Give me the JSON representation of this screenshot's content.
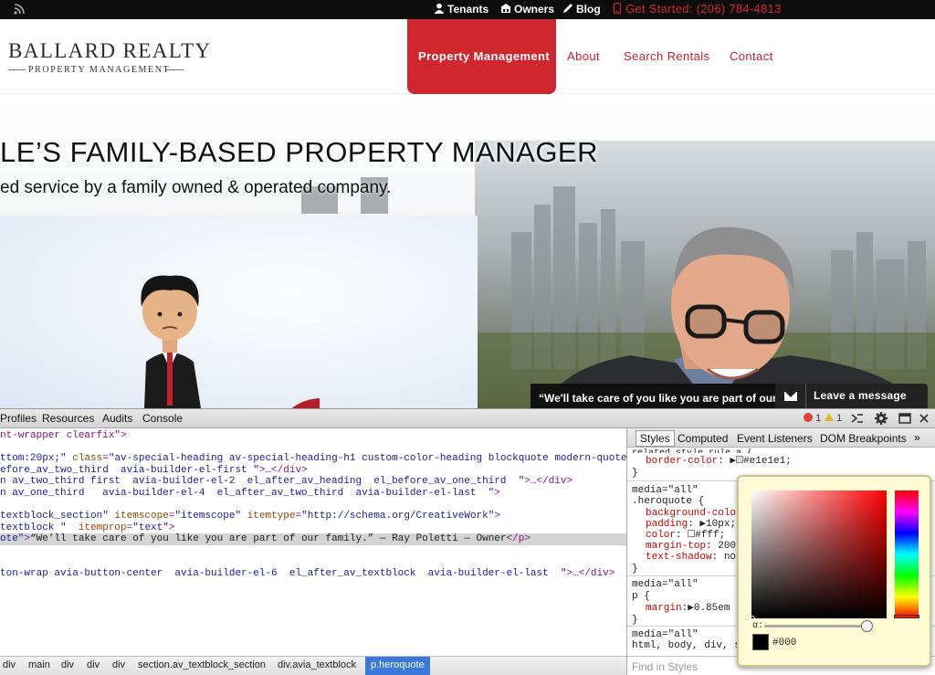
{
  "topbar": {
    "tenants": "Tenants",
    "owners": "Owners",
    "blog": "Blog",
    "get_started": "Get Started: (206) 784-4813"
  },
  "header": {
    "logo_main": "BALLARD REALTY",
    "logo_sub": "PROPERTY MANAGEMENT",
    "nav": [
      "Property Management",
      "About",
      "Search Rentals",
      "Contact"
    ]
  },
  "hero": {
    "title": "LE’S FAMILY-BASED PROPERTY MANAGER",
    "subtitle": "ed service by a family owned & operated company.",
    "quote": "“We'll take care of you like you are part of our",
    "leave_message": "Leave a message",
    "video_badge": "IS SU"
  },
  "devtools": {
    "tabs": [
      "Profiles",
      "Resources",
      "Audits",
      "Console"
    ],
    "error_count": "1",
    "warning_count": "1",
    "dom_lines": [
      {
        "parts": [
          [
            "tg",
            "nt-wrapper clearfix\">"
          ]
        ]
      },
      {
        "parts": [
          [
            "tg",
            ""
          ]
        ]
      },
      {
        "parts": [
          [
            "av",
            "ttom:20px;\""
          ],
          [
            "an",
            " class"
          ],
          [
            "tg",
            "="
          ],
          [
            "av",
            "\"av-special-heading av-special-heading-h1 custom-color-heading blockquote modern-quote"
          ]
        ]
      },
      {
        "parts": [
          [
            "av",
            "efore_av_two_third  avia-builder-el-first \""
          ],
          [
            "tg",
            ">…</div>"
          ]
        ]
      },
      {
        "parts": [
          [
            "av",
            "n av_two_third first  avia-builder-el-2  el_after_av_heading  el_before_av_one_third  \""
          ],
          [
            "tg",
            ">…</div>"
          ]
        ]
      },
      {
        "parts": [
          [
            "av",
            "n av_one_third   avia-builder-el-4  el_after_av_two_third  avia-builder-el-last  \""
          ],
          [
            "tg",
            ">"
          ]
        ]
      },
      {
        "parts": [
          [
            "tg",
            ""
          ]
        ]
      },
      {
        "parts": [
          [
            "av",
            "textblock_section\""
          ],
          [
            "an",
            " itemscope"
          ],
          [
            "tg",
            "="
          ],
          [
            "av",
            "\"itemscope\""
          ],
          [
            "an",
            " itemtype"
          ],
          [
            "tg",
            "="
          ],
          [
            "av",
            "\"http://schema.org/CreativeWork\""
          ],
          [
            "tg",
            ">"
          ]
        ]
      },
      {
        "parts": [
          [
            "av",
            "textblock \""
          ],
          [
            "an",
            "  itemprop"
          ],
          [
            "tg",
            "="
          ],
          [
            "av",
            "\"text\""
          ],
          [
            "tg",
            ">"
          ]
        ]
      },
      {
        "parts": [
          [
            "av",
            "ote\""
          ],
          [
            "tg",
            ">"
          ],
          [
            "tx",
            "“We’ll take care of you like you are part of our family.” — Ray Poletti — Owner"
          ],
          [
            "tg",
            "</p>"
          ]
        ]
      },
      {
        "parts": [
          [
            "tg",
            ""
          ]
        ]
      },
      {
        "parts": [
          [
            "tg",
            ""
          ]
        ]
      },
      {
        "parts": [
          [
            "av",
            "ton-wrap avia-button-center  avia-builder-el-6  el_after_av_textblock  avia-builder-el-last  \""
          ],
          [
            "tg",
            ">…</div>"
          ]
        ]
      }
    ],
    "breadcrumbs": [
      "div",
      "main",
      "div",
      "div",
      "div",
      "section.av_textblock_section",
      "div.avia_textblock",
      "p.heroquote"
    ],
    "sidebar_tabs": [
      "Styles",
      "Computed",
      "Event Listeners",
      "DOM Breakpoints"
    ],
    "css_lines": {
      "related": "related style rule a {",
      "border_prop": "border-color",
      "border_val": "#e1e1e1;",
      "brace1": "}",
      "media1": "media=\"all\"",
      "selector1": ".heroquote {",
      "p1": "background-color",
      "p2": "padding",
      "p2v": "10px;",
      "p3": "color",
      "p3v": "#fff;",
      "p4": "margin-top",
      "p4v": "200p",
      "p5": "text-shadow",
      "p5v": "non",
      "brace2": "}",
      "media2": "media=\"all\"",
      "selector2": "p {",
      "p6": "margin",
      "p6v": "0.85em",
      "brace3": "}",
      "media3": "media=\"all\"",
      "selector3": "html, body, div, s"
    },
    "find_placeholder": "Find in Styles",
    "picker": {
      "alpha_label": "α:",
      "hex": "#000"
    }
  }
}
